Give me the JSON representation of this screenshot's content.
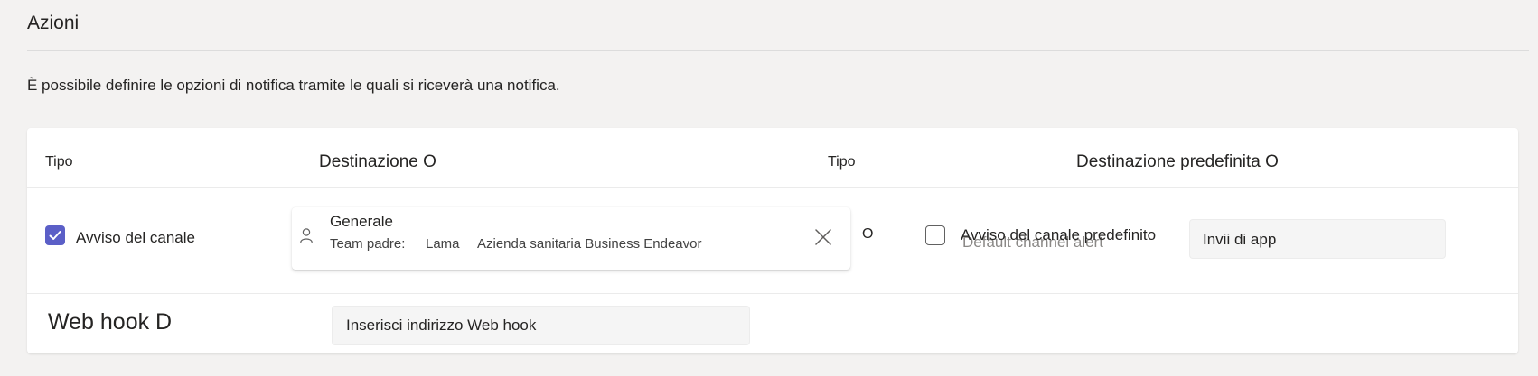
{
  "section": {
    "title": "Azioni",
    "description": "È possibile definire le opzioni di notifica tramite le quali si riceverà una notifica."
  },
  "table": {
    "headers": {
      "type1": "Tipo",
      "destination": "Destinazione O",
      "type2": "Tipo",
      "default_destination": "Destinazione predefinita O"
    },
    "channel_alert": {
      "checked": true,
      "label": "Avviso del canale"
    },
    "selected_channel": {
      "name": "Generale",
      "parent_team_label": "Team padre:",
      "parent_team_value": "Lama",
      "organization": "Azienda sanitaria Business Endeavor"
    },
    "or_text": "O",
    "default_channel_alert": {
      "checked": false,
      "label": "Avviso del canale predefinito",
      "overlapping_text": "Default channel alert"
    },
    "default_destination_value": "Invii di app",
    "webhook": {
      "label": "Web hook D",
      "placeholder": "Inserisci indirizzo Web hook",
      "value": ""
    }
  },
  "colors": {
    "accent": "#5b5fc7",
    "background": "#f3f2f1",
    "card": "#ffffff"
  },
  "icons": [
    "checkmark-icon",
    "person-icon",
    "close-icon"
  ]
}
